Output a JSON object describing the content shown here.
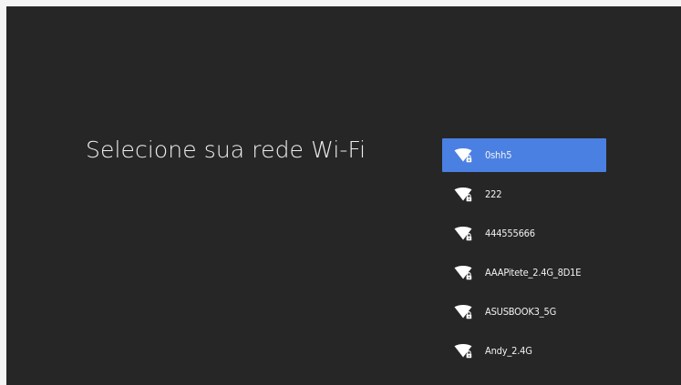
{
  "page": {
    "title": "Selecione sua rede Wi-Fi"
  },
  "networks": [
    {
      "ssid": "0shh5",
      "selected": true,
      "secured": true,
      "icon": "wifi-lock-icon"
    },
    {
      "ssid": "222",
      "selected": false,
      "secured": true,
      "icon": "wifi-lock-icon"
    },
    {
      "ssid": "444555666",
      "selected": false,
      "secured": true,
      "icon": "wifi-lock-icon"
    },
    {
      "ssid": "AAAPitete_2.4G_8D1E",
      "selected": false,
      "secured": true,
      "icon": "wifi-lock-icon"
    },
    {
      "ssid": "ASUSBOOK3_5G",
      "selected": false,
      "secured": true,
      "icon": "wifi-lock-icon"
    },
    {
      "ssid": "Andy_2.4G",
      "selected": false,
      "secured": true,
      "icon": "wifi-lock-icon"
    }
  ],
  "colors": {
    "background": "#262626",
    "selected": "#4a80e2",
    "text": "#f2f2f2"
  }
}
